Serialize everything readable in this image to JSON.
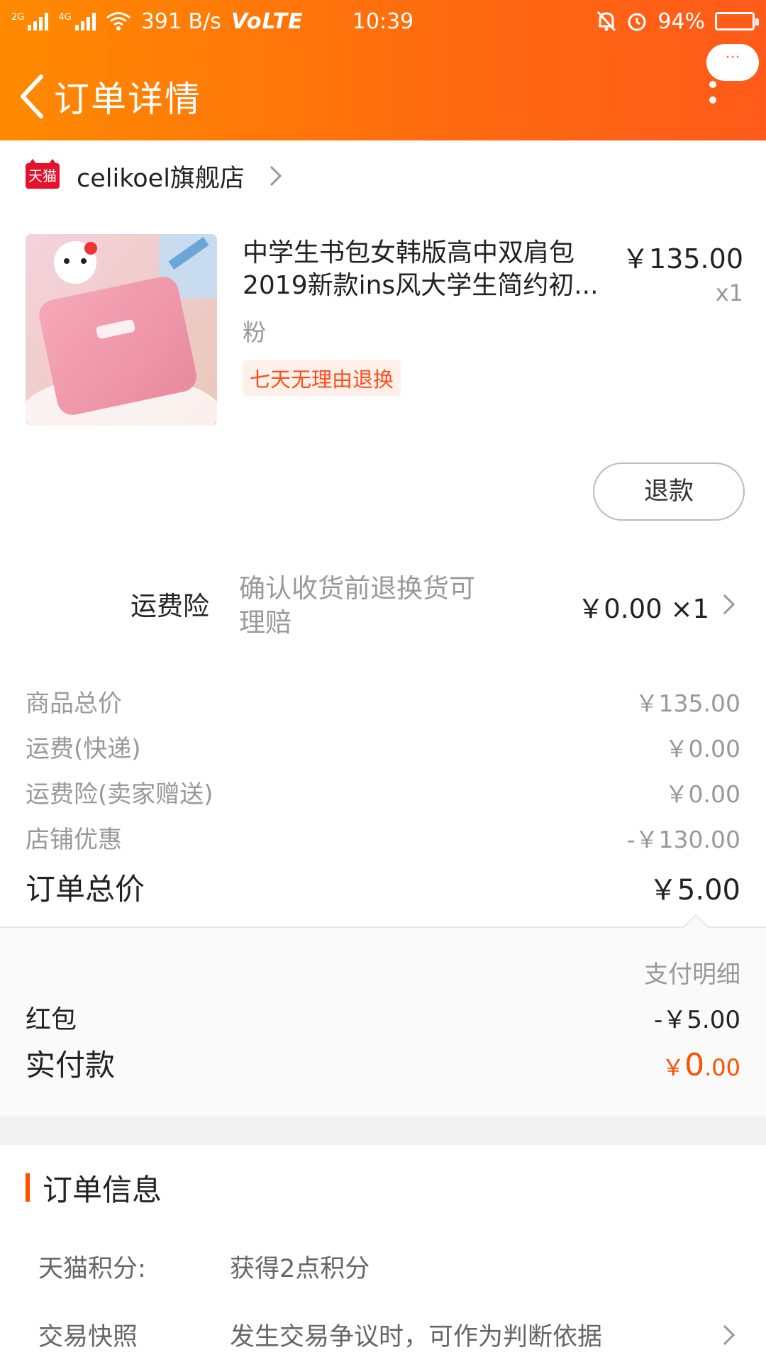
{
  "status_bar": {
    "net_speed": "391 B/s",
    "volte": "VoLTE",
    "time": "10:39",
    "battery": "94%",
    "sig1": "2G",
    "sig2": "4G"
  },
  "nav": {
    "title": "订单详情",
    "more_bubble": "···"
  },
  "shop": {
    "badge": "天猫",
    "name": "celikoel旗舰店"
  },
  "product": {
    "title": "中学生书包女韩版高中双肩包2019新款ins风大学生简约初...",
    "price": "￥135.00",
    "qty": "x1",
    "sku": "粉",
    "tag": "七天无理由退换",
    "refund_button": "退款"
  },
  "insurance": {
    "label": "运费险",
    "desc": "确认收货前退换货可理赔",
    "price": "￥0.00 ×1"
  },
  "summary": [
    {
      "k": "商品总价",
      "v": "￥135.00"
    },
    {
      "k": "运费(快递)",
      "v": "￥0.00"
    },
    {
      "k": "运费险(卖家赠送)",
      "v": "￥0.00"
    },
    {
      "k": "店铺优惠",
      "v": "-￥130.00"
    }
  ],
  "total": {
    "k": "订单总价",
    "v": "￥5.00"
  },
  "payment": {
    "detail_label": "支付明细",
    "redpacket": {
      "k": "红包",
      "v": "-￥5.00"
    },
    "actual": {
      "k": "实付款",
      "currency": "￥",
      "int": "0",
      "dec": ".00"
    }
  },
  "order_info": {
    "title": "订单信息",
    "rows": [
      {
        "k": "天猫积分:",
        "v": "获得2点积分"
      },
      {
        "k": "交易快照",
        "v": "发生交易争议时，可作为判断依据"
      }
    ]
  },
  "colors": {
    "header_start": "#ff8a00",
    "header_end": "#ff5a1a",
    "accent": "#ff5000",
    "tmall_red": "#e4122b"
  }
}
